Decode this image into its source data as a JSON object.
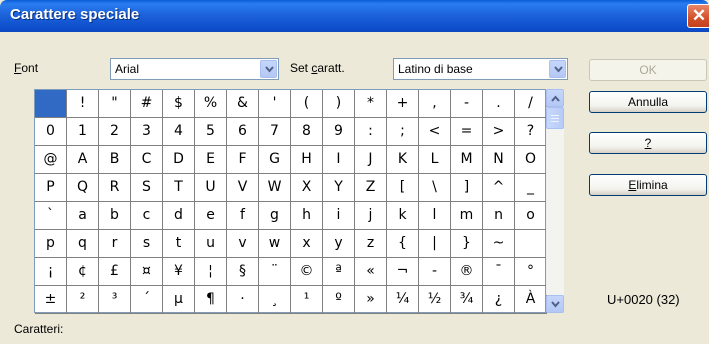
{
  "window": {
    "title": "Carattere speciale",
    "close_glyph": "✕"
  },
  "font_label_prefix": "F",
  "font_label_rest": "ont",
  "font_value": "Arial",
  "charset_label_a": "Set ",
  "charset_label_b": "c",
  "charset_label_c": "aratt.",
  "charset_value": "Latino di base",
  "buttons": {
    "ok": "OK",
    "annulla": "Annulla",
    "help": "?",
    "elimina_u": "E",
    "elimina_rest": "limina"
  },
  "code_readout": "U+0020 (32)",
  "caratteri_label": "Caratteri:",
  "characters": [
    " ",
    "!",
    "\"",
    "#",
    "$",
    "%",
    "&",
    "'",
    "(",
    ")",
    "*",
    "+",
    ",",
    "-",
    ".",
    "/",
    "0",
    "1",
    "2",
    "3",
    "4",
    "5",
    "6",
    "7",
    "8",
    "9",
    ":",
    ";",
    "<",
    "=",
    ">",
    "?",
    "@",
    "A",
    "B",
    "C",
    "D",
    "E",
    "F",
    "G",
    "H",
    "I",
    "J",
    "K",
    "L",
    "M",
    "N",
    "O",
    "P",
    "Q",
    "R",
    "S",
    "T",
    "U",
    "V",
    "W",
    "X",
    "Y",
    "Z",
    "[",
    "\\",
    "]",
    "^",
    "_",
    "`",
    "a",
    "b",
    "c",
    "d",
    "e",
    "f",
    "g",
    "h",
    "i",
    "j",
    "k",
    "l",
    "m",
    "n",
    "o",
    "p",
    "q",
    "r",
    "s",
    "t",
    "u",
    "v",
    "w",
    "x",
    "y",
    "z",
    "{",
    "|",
    "}",
    "~",
    " ",
    "¡",
    "¢",
    "£",
    "¤",
    "¥",
    "¦",
    "§",
    "¨",
    "©",
    "ª",
    "«",
    "¬",
    "-",
    "®",
    "¯",
    "°",
    "±",
    "²",
    "³",
    "´",
    "µ",
    "¶",
    "·",
    "¸",
    "¹",
    "º",
    "»",
    "¼",
    "½",
    "¾",
    "¿",
    "À"
  ],
  "selected_index": 0,
  "colors": {
    "title_bar": "#0a5fd8",
    "selection": "#316ac5",
    "dialog_bg": "#ece9d8"
  }
}
